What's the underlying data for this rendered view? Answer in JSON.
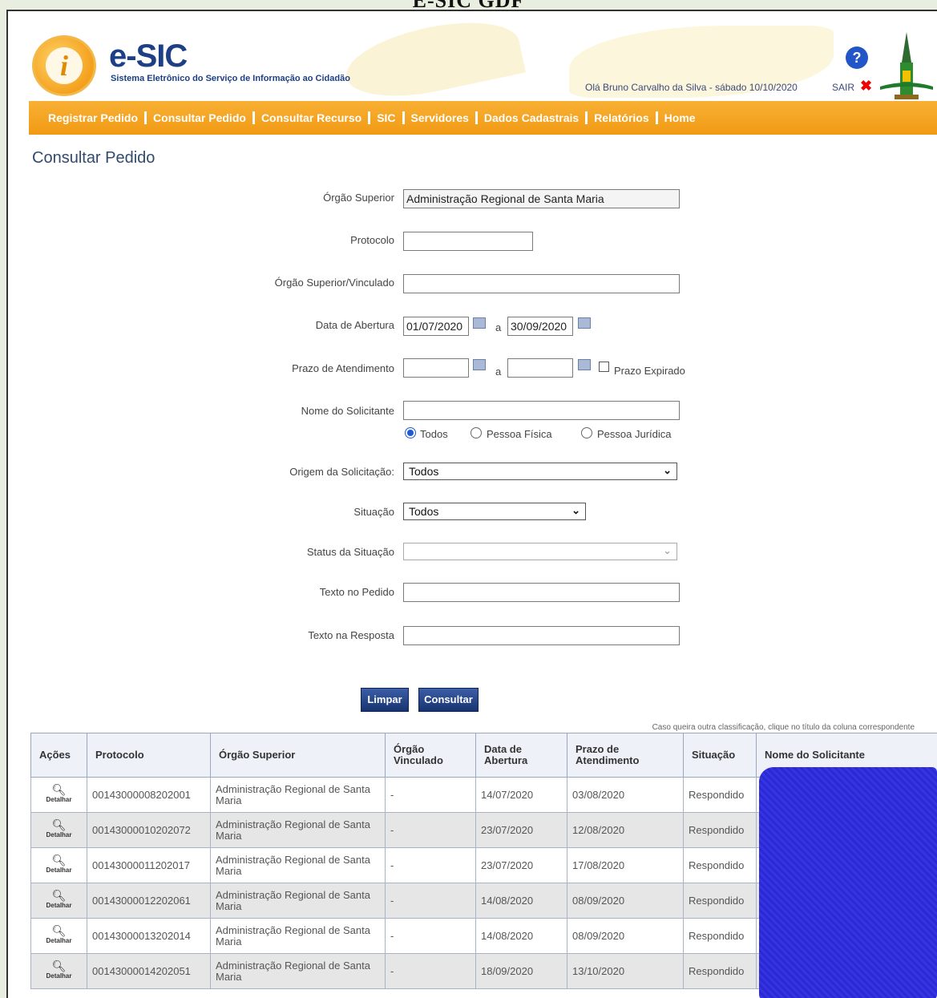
{
  "window": {
    "caption": "E-SIC GDF"
  },
  "header": {
    "brand": "e-SIC",
    "subtitle": "Sistema Eletrônico do Serviço de Informação ao Cidadão",
    "greeting": "Olá Bruno Carvalho da Silva - sábado 10/10/2020",
    "logout": "SAIR",
    "help_icon": "?",
    "logout_icon": "✖"
  },
  "nav": {
    "items": [
      "Registrar Pedido",
      "Consultar Pedido",
      "Consultar Recurso",
      "SIC",
      "Servidores",
      "Dados Cadastrais",
      "Relatórios",
      "Home"
    ]
  },
  "page": {
    "title": "Consultar Pedido"
  },
  "form": {
    "orgao_superior": {
      "label": "Órgão Superior",
      "value": "Administração Regional de Santa Maria"
    },
    "protocolo": {
      "label": "Protocolo",
      "value": ""
    },
    "orgao_vinculado": {
      "label": "Órgão Superior/Vinculado",
      "value": ""
    },
    "data_abertura": {
      "label": "Data de Abertura",
      "from": "01/07/2020",
      "to": "30/09/2020",
      "sep": "a"
    },
    "prazo": {
      "label": "Prazo de Atendimento",
      "from": "",
      "to": "",
      "sep": "a",
      "expired_label": "Prazo Expirado"
    },
    "nome": {
      "label": "Nome do Solicitante",
      "value": ""
    },
    "tipo_pessoa": {
      "options": [
        "Todos",
        "Pessoa Física",
        "Pessoa Jurídica"
      ],
      "selected": "Todos"
    },
    "origem": {
      "label": "Origem da Solicitação:",
      "value": "Todos"
    },
    "situacao": {
      "label": "Situação",
      "value": "Todos"
    },
    "status": {
      "label": "Status da Situação",
      "value": ""
    },
    "texto_pedido": {
      "label": "Texto no Pedido",
      "value": ""
    },
    "texto_resposta": {
      "label": "Texto na Resposta",
      "value": ""
    },
    "btn_limpar": "Limpar",
    "btn_consultar": "Consultar"
  },
  "table": {
    "note": "Caso queira outra classificação, clique no título da coluna correspondente",
    "headers": [
      "Ações",
      "Protocolo",
      "Órgão Superior",
      "Órgão Vinculado",
      "Data de Abertura",
      "Prazo de Atendimento",
      "Situação",
      "Nome do Solicitante"
    ],
    "action_label": "Detalhar",
    "rows": [
      {
        "protocolo": "00143000008202001",
        "orgao": "Administração Regional de Santa Maria",
        "vinculado": "-",
        "abertura": "14/07/2020",
        "prazo": "03/08/2020",
        "situacao": "Respondido"
      },
      {
        "protocolo": "00143000010202072",
        "orgao": "Administração Regional de Santa Maria",
        "vinculado": "-",
        "abertura": "23/07/2020",
        "prazo": "12/08/2020",
        "situacao": "Respondido"
      },
      {
        "protocolo": "00143000011202017",
        "orgao": "Administração Regional de Santa Maria",
        "vinculado": "-",
        "abertura": "23/07/2020",
        "prazo": "17/08/2020",
        "situacao": "Respondido"
      },
      {
        "protocolo": "00143000012202061",
        "orgao": "Administração Regional de Santa Maria",
        "vinculado": "-",
        "abertura": "14/08/2020",
        "prazo": "08/09/2020",
        "situacao": "Respondido"
      },
      {
        "protocolo": "00143000013202014",
        "orgao": "Administração Regional de Santa Maria",
        "vinculado": "-",
        "abertura": "14/08/2020",
        "prazo": "08/09/2020",
        "situacao": "Respondido"
      },
      {
        "protocolo": "00143000014202051",
        "orgao": "Administração Regional de Santa Maria",
        "vinculado": "-",
        "abertura": "18/09/2020",
        "prazo": "13/10/2020",
        "situacao": "Respondido"
      }
    ]
  }
}
